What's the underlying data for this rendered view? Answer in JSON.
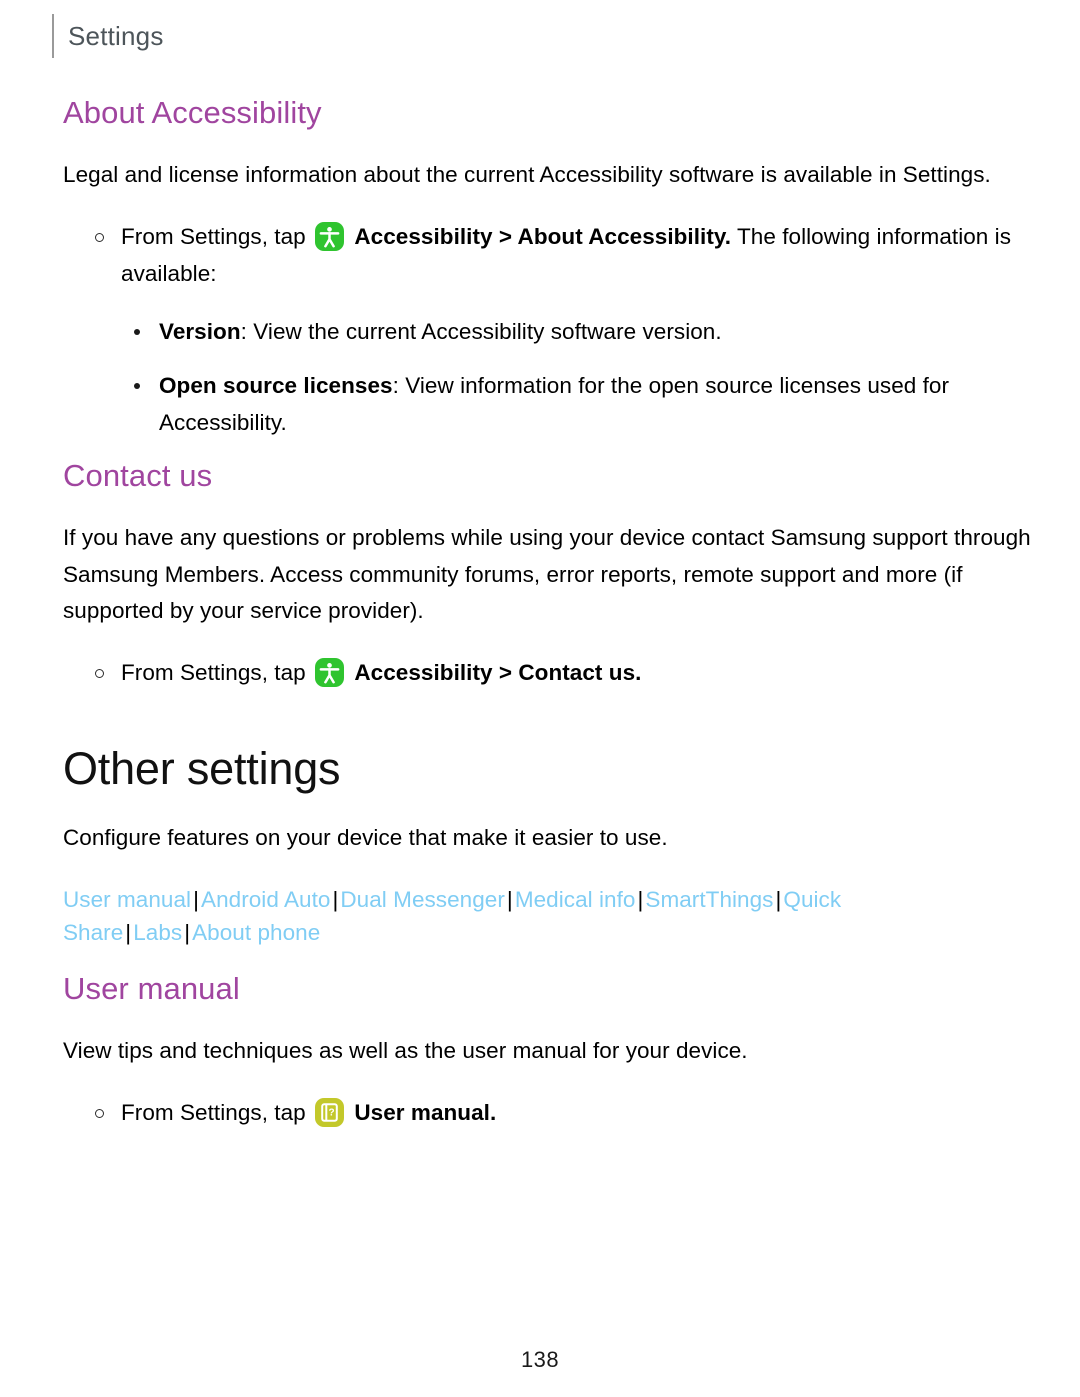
{
  "running_head": {
    "label": "Settings"
  },
  "sections": {
    "about_accessibility": {
      "heading": "About Accessibility",
      "intro": "Legal and license information about the current Accessibility software is available in Settings.",
      "step": {
        "prefix": "From Settings, tap",
        "icon_name": "accessibility-icon",
        "icon_color": "#2fc42f",
        "bold_path": "Accessibility > About Accessibility.",
        "suffix": "The following information is available:"
      },
      "bullets": [
        {
          "term": "Version",
          "description": ": View the current Accessibility software version."
        },
        {
          "term": "Open source licenses",
          "description": ": View information for the open source licenses used for Accessibility."
        }
      ]
    },
    "contact_us": {
      "heading": "Contact us",
      "intro": "If you have any questions or problems while using your device contact Samsung support through Samsung Members. Access community forums, error reports, remote support and more (if supported by your service provider).",
      "step": {
        "prefix": "From Settings, tap",
        "icon_name": "accessibility-icon",
        "icon_color": "#2fc42f",
        "bold_path": "Accessibility > Contact us."
      }
    },
    "other_settings": {
      "heading": "Other settings",
      "intro": "Configure features on your device that make it easier to use.",
      "links": [
        "User manual",
        "Android Auto",
        "Dual Messenger",
        "Medical info",
        "SmartThings",
        "Quick Share",
        "Labs",
        "About phone"
      ],
      "link_separator": "|",
      "link_color": "#80cdf4"
    },
    "user_manual": {
      "heading": "User manual",
      "intro": "View tips and techniques as well as the user manual for your device.",
      "step": {
        "prefix": "From Settings, tap",
        "icon_name": "user-manual-icon",
        "icon_color": "#c3c82a",
        "bold_path": "User manual."
      }
    }
  },
  "footer": {
    "page_number": "138"
  },
  "theme": {
    "heading_purple": "#a0459f",
    "heading_black": "#111111",
    "link_blue": "#80cdf4",
    "running_head_gray": "#4d555a"
  }
}
